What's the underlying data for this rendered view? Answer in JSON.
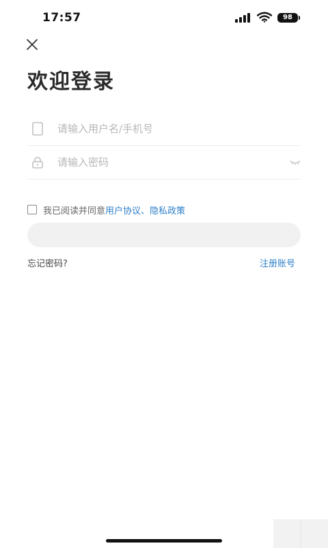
{
  "status_bar": {
    "time": "17:57",
    "battery": "98",
    "icons": [
      "signal-icon",
      "wifi-icon",
      "battery-icon"
    ]
  },
  "header": {
    "close_icon": "close-icon",
    "title": "欢迎登录"
  },
  "form": {
    "username": {
      "placeholder": "请输入用户名/手机号",
      "value": "",
      "icon": "phone-icon"
    },
    "password": {
      "placeholder": "请输入密码",
      "value": "",
      "icon": "lock-icon",
      "toggle_icon": "eye-closed-icon"
    }
  },
  "agreement": {
    "checked": false,
    "prefix": "我已阅读并同意",
    "user_agreement": "用户协议",
    "separator": "、",
    "privacy_policy": "隐私政策"
  },
  "actions": {
    "login_label": "",
    "forgot_password": "忘记密码?",
    "register": "注册账号"
  },
  "colors": {
    "link": "#2f80c8",
    "title": "#2a2a2a",
    "placeholder": "#b7b7b7",
    "button_bg": "#f1f1f1"
  }
}
